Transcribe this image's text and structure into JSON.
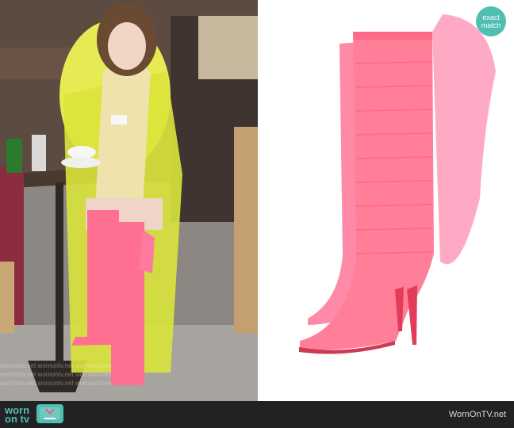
{
  "badge": {
    "line1": "exact",
    "line2": "match"
  },
  "watermark": {
    "text": "wornontv.net   wornontv.net   wornontv.net"
  },
  "footer": {
    "logo_line1": "worn",
    "logo_line2": "on tv",
    "site": "WornOnTV.net"
  },
  "colors": {
    "accent": "#4fbfb2",
    "boot_pink": "#ff6f92",
    "coat_yellow": "#d9e43a"
  }
}
